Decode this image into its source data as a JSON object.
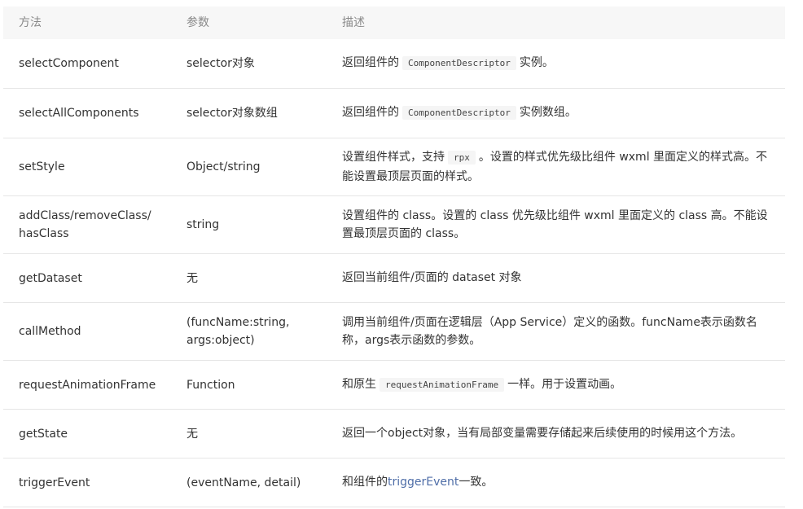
{
  "header": {
    "method": "方法",
    "params": "参数",
    "description": "描述"
  },
  "rows": [
    {
      "method": "selectComponent",
      "params": "selector对象",
      "desc_pre": "返回组件的",
      "desc_code": "ComponentDescriptor",
      "desc_post": "实例。"
    },
    {
      "method": "selectAllComponents",
      "params": "selector对象数组",
      "desc_pre": "返回组件的",
      "desc_code": "ComponentDescriptor",
      "desc_post": "实例数组。"
    },
    {
      "method": "setStyle",
      "params": "Object/string",
      "desc_pre": "设置组件样式，支持",
      "desc_code": "rpx",
      "desc_post": "。设置的样式优先级比组件 wxml 里面定义的样式高。不能设置最顶层页面的样式。"
    },
    {
      "method": "addClass/removeClass/",
      "method2": "hasClass",
      "params": "string",
      "desc": "设置组件的 class。设置的 class 优先级比组件 wxml 里面定义的 class 高。不能设置最顶层页面的 class。"
    },
    {
      "method": "getDataset",
      "params": "无",
      "desc": "返回当前组件/页面的 dataset 对象"
    },
    {
      "method": "callMethod",
      "params": "(funcName:string,",
      "params2": "args:object)",
      "desc": "调用当前组件/页面在逻辑层（App Service）定义的函数。funcName表示函数名称，args表示函数的参数。"
    },
    {
      "method": "requestAnimationFrame",
      "params": "Function",
      "desc_pre": "和原生",
      "desc_code": "requestAnimationFrame",
      "desc_post": "一样。用于设置动画。"
    },
    {
      "method": "getState",
      "params": "无",
      "desc": "返回一个object对象，当有局部变量需要存储起来后续使用的时候用这个方法。"
    },
    {
      "method": "triggerEvent",
      "params": "(eventName, detail)",
      "desc_pre": "和组件的",
      "desc_link": "triggerEvent",
      "desc_post": "一致。"
    }
  ]
}
